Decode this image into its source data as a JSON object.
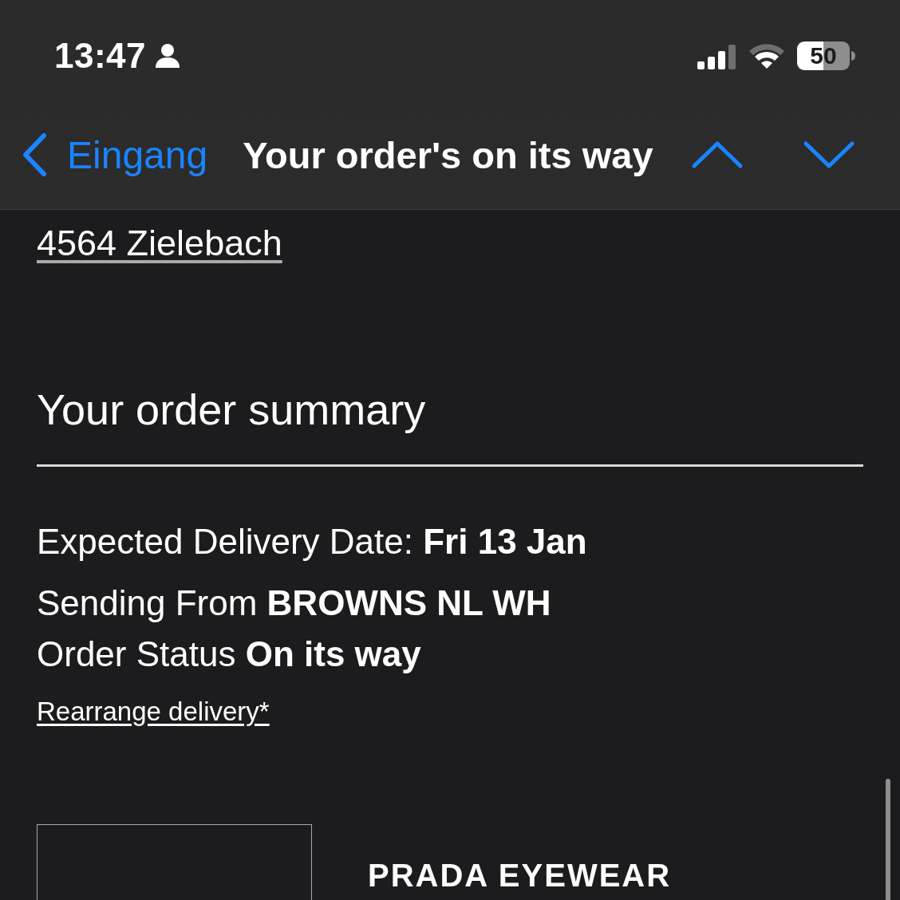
{
  "status_bar": {
    "time": "13:47",
    "battery": "50"
  },
  "nav": {
    "back_label": "Eingang",
    "title": "Your order's on its way"
  },
  "address_line": "4564 Zielebach",
  "summary": {
    "heading": "Your order summary",
    "details": [
      "Expected Delivery Date: **Fri 13 Jan**",
      "Sending From **BROWNS NL WH**",
      "Order Status **On its way**"
    ],
    "link": "Rearrange delivery*"
  },
  "product": {
    "brand": "PRADA EYEWEAR"
  }
}
